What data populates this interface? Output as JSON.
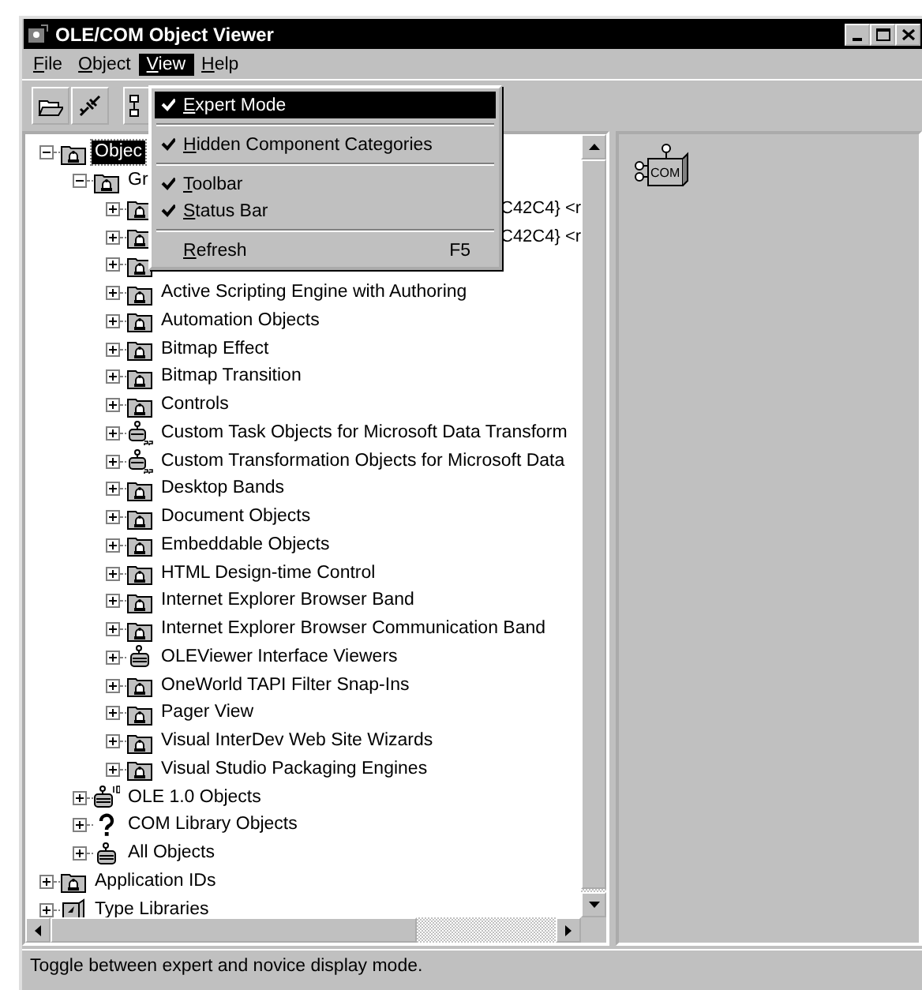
{
  "window": {
    "title": "OLE/COM Object Viewer"
  },
  "menu_bar": [
    {
      "label": "File",
      "selected": false
    },
    {
      "label": "Object",
      "selected": false
    },
    {
      "label": "View",
      "selected": true
    },
    {
      "label": "Help",
      "selected": false
    }
  ],
  "view_menu": [
    {
      "kind": "item",
      "label": "Expert Mode",
      "checked": true,
      "selected": true
    },
    {
      "kind": "separator"
    },
    {
      "kind": "item",
      "label": "Hidden Component Categories",
      "checked": true,
      "selected": false
    },
    {
      "kind": "separator"
    },
    {
      "kind": "item",
      "label": "Toolbar",
      "checked": true,
      "selected": false
    },
    {
      "kind": "item",
      "label": "Status Bar",
      "checked": true,
      "selected": false
    },
    {
      "kind": "separator"
    },
    {
      "kind": "item",
      "label": "Refresh",
      "shortcut": "F5",
      "checked": false,
      "selected": false
    }
  ],
  "tree": [
    {
      "label": "Objec",
      "kind": "folder",
      "expanded": true,
      "selected": true,
      "children": [
        {
          "label": "Gr",
          "kind": "folder",
          "expanded": true,
          "selected": false,
          "children": [
            {
              "label": "C42C4} <r",
              "covered": true,
              "kind": "folder",
              "expanded": false,
              "selected": false
            },
            {
              "label": "C42C4} <r",
              "covered": true,
              "kind": "folder",
              "expanded": false,
              "selected": false
            },
            {
              "kind": "folder",
              "expanded": false,
              "selected": false
            },
            {
              "label": "Active Scripting Engine with Authoring",
              "kind": "folder",
              "expanded": false,
              "selected": false
            },
            {
              "label": "Automation Objects",
              "kind": "folder",
              "expanded": false,
              "selected": false
            },
            {
              "label": "Bitmap Effect",
              "kind": "folder",
              "expanded": false,
              "selected": false
            },
            {
              "label": "Bitmap Transition",
              "kind": "folder",
              "expanded": false,
              "selected": false
            },
            {
              "label": "Controls",
              "kind": "folder",
              "expanded": false,
              "selected": false
            },
            {
              "label": "Custom Task Objects for Microsoft Data Transform",
              "kind": "component32",
              "expanded": false,
              "selected": false
            },
            {
              "label": "Custom Transformation Objects for Microsoft Data",
              "kind": "component32",
              "expanded": false,
              "selected": false
            },
            {
              "label": "Desktop Bands",
              "kind": "folder",
              "expanded": false,
              "selected": false
            },
            {
              "label": "Document Objects",
              "kind": "folder",
              "expanded": false,
              "selected": false
            },
            {
              "label": "Embeddable Objects",
              "kind": "folder",
              "expanded": false,
              "selected": false
            },
            {
              "label": "HTML Design-time Control",
              "kind": "folder",
              "expanded": false,
              "selected": false
            },
            {
              "label": "Internet Explorer Browser Band",
              "kind": "folder",
              "expanded": false,
              "selected": false
            },
            {
              "label": "Internet Explorer Browser Communication Band",
              "kind": "folder",
              "expanded": false,
              "selected": false
            },
            {
              "label": "OLEViewer Interface Viewers",
              "kind": "component",
              "expanded": false,
              "selected": false
            },
            {
              "label": "OneWorld TAPI Filter Snap-Ins",
              "kind": "folder",
              "expanded": false,
              "selected": false
            },
            {
              "label": "Pager View",
              "kind": "folder",
              "expanded": false,
              "selected": false
            },
            {
              "label": "Visual InterDev Web Site Wizards",
              "kind": "folder",
              "expanded": false,
              "selected": false
            },
            {
              "label": "Visual Studio Packaging Engines",
              "kind": "folder",
              "expanded": false,
              "selected": false
            }
          ]
        },
        {
          "label": "OLE 1.0 Objects",
          "kind": "component10",
          "expanded": false,
          "selected": false
        },
        {
          "label": "COM Library Objects",
          "kind": "question",
          "expanded": false,
          "selected": false
        },
        {
          "label": "All Objects",
          "kind": "component",
          "expanded": false,
          "selected": false
        }
      ]
    },
    {
      "label": "Application IDs",
      "kind": "folder",
      "expanded": false,
      "selected": false
    },
    {
      "label": "Type Libraries",
      "kind": "book",
      "expanded": false,
      "selected": false
    }
  ],
  "object_pane": {
    "icon_label": "COM"
  },
  "status_bar": {
    "text": "Toggle between expert and novice display mode."
  }
}
